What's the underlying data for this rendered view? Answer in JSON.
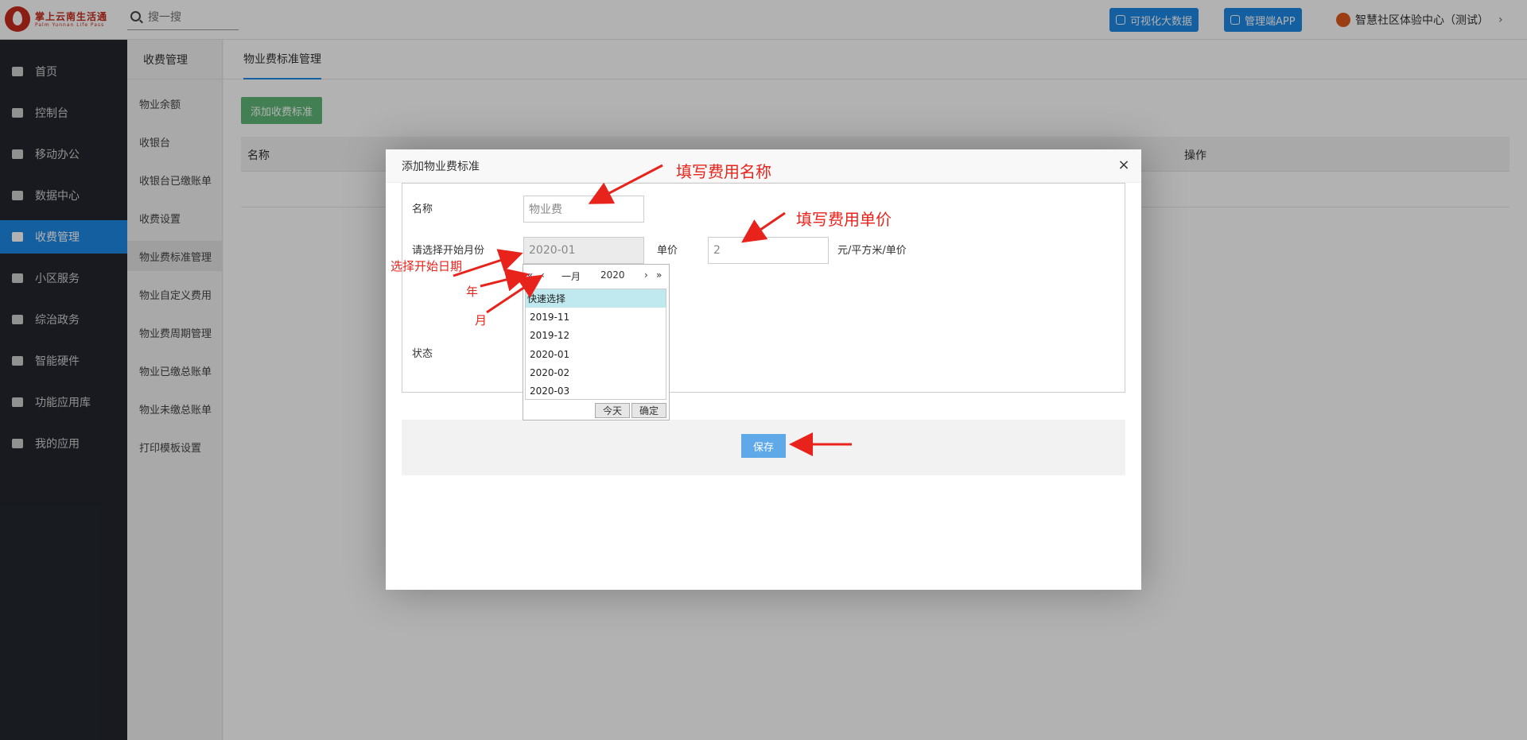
{
  "header": {
    "brand_cn": "掌上云南生活通",
    "brand_en": "Palm Yunnan Life Pass",
    "search_placeholder": "搜一搜",
    "btn_bigdata": "可视化大数据",
    "btn_app": "管理端APP",
    "user_name": "智慧社区体验中心（测试）",
    "chevron": "›"
  },
  "leftnav": {
    "items": [
      {
        "label": "首页",
        "icon": "home-icon"
      },
      {
        "label": "控制台",
        "icon": "laptop-icon"
      },
      {
        "label": "移动办公",
        "icon": "mobile-icon"
      },
      {
        "label": "数据中心",
        "icon": "briefcase-icon"
      },
      {
        "label": "收费管理",
        "icon": "credit-card-icon"
      },
      {
        "label": "小区服务",
        "icon": "home-icon"
      },
      {
        "label": "综治政务",
        "icon": "bank-icon"
      },
      {
        "label": "智能硬件",
        "icon": "wrench-icon"
      },
      {
        "label": "功能应用库",
        "icon": "cloud-download-icon"
      },
      {
        "label": "我的应用",
        "icon": "cloud-icon"
      }
    ],
    "active_index": 4
  },
  "subnav": {
    "header": "收费管理",
    "items": [
      "物业余额",
      "收银台",
      "收银台已缴账单",
      "收费设置",
      "物业费标准管理",
      "物业自定义费用",
      "物业费周期管理",
      "物业已缴总账单",
      "物业未缴总账单",
      "打印模板设置"
    ],
    "active_index": 4
  },
  "main": {
    "tab": "物业费标准管理",
    "add_button": "添加收费标准",
    "columns": [
      "名称",
      "操作"
    ]
  },
  "modal": {
    "title": "添加物业费标准",
    "close": "×",
    "name_label": "名称",
    "name_value": "物业费",
    "month_label": "请选择开始月份",
    "month_value": "2020-01",
    "price_label": "单价",
    "price_value": "2",
    "price_unit": "元/平方米/单价",
    "status_label": "状态",
    "save_button": "保存"
  },
  "picker": {
    "prev_year": "«",
    "prev_month": "‹",
    "month": "一月",
    "year": "2020",
    "next_month": "›",
    "next_year": "»",
    "quick_select": "快速选择",
    "options": [
      "2019-11",
      "2019-12",
      "2020-01",
      "2020-02",
      "2020-03"
    ],
    "today_button": "今天",
    "ok_button": "确定"
  },
  "annotations": {
    "fill_name": "填写费用名称",
    "fill_price": "填写费用单价",
    "select_date": "选择开始日期",
    "year": "年",
    "month": "月"
  },
  "colors": {
    "accent": "#1e88e5",
    "nav_bg": "#23262e",
    "add_button": "#5fb878",
    "annotation": "#e8231c",
    "brand": "#c62b1e"
  }
}
